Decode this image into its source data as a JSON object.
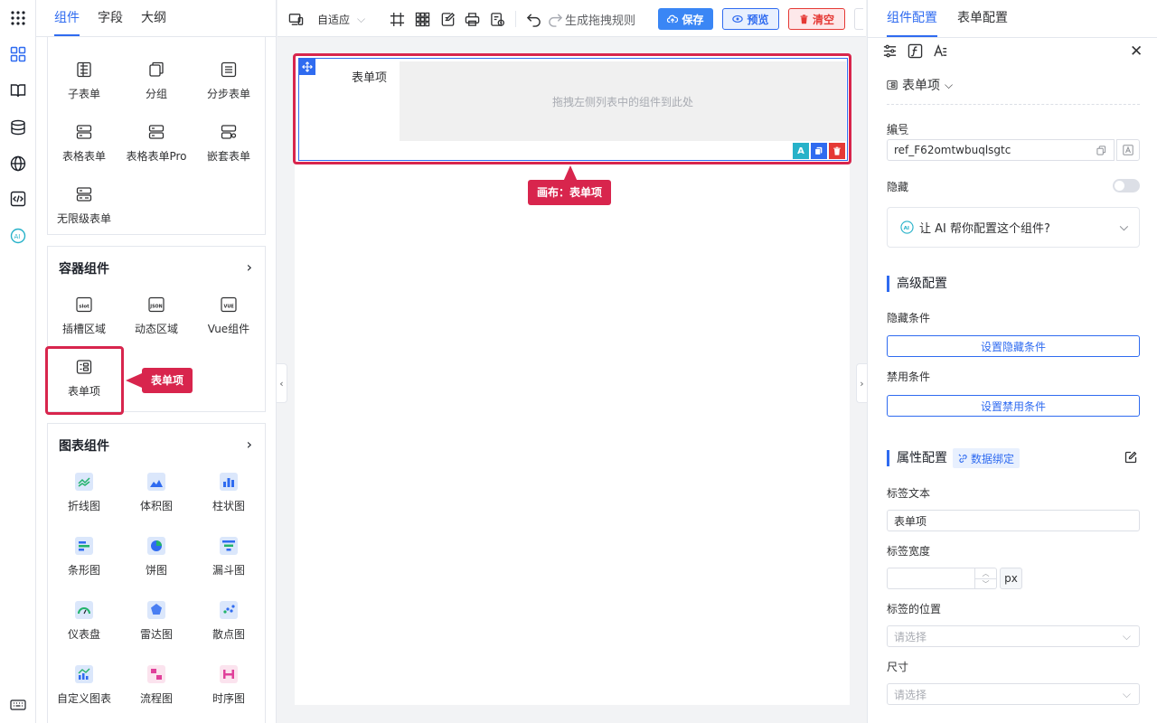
{
  "panel": {
    "tabs": [
      "组件",
      "字段",
      "大纲"
    ],
    "section1_items": [
      "子表单",
      "分组",
      "分步表单",
      "表格表单",
      "表格表单Pro",
      "嵌套表单",
      "无限级表单"
    ],
    "container_title": "容器组件",
    "container_items": [
      "插槽区域",
      "动态区域",
      "Vue组件",
      "表单项"
    ],
    "chart_title": "图表组件",
    "chart_items": [
      "折线图",
      "体积图",
      "柱状图",
      "条形图",
      "饼图",
      "漏斗图",
      "仪表盘",
      "雷达图",
      "散点图",
      "自定义图表",
      "流程图",
      "时序图"
    ],
    "icon_texts": [
      "slot",
      "JSON",
      "VUE"
    ],
    "callout": "表单项"
  },
  "toolbar": {
    "adaptive": "自适应",
    "gen_rule": "生成拖拽规则",
    "save": "保存",
    "preview": "预览",
    "clear": "清空"
  },
  "canvas": {
    "item_label": "表单项",
    "placeholder": "拖拽左侧列表中的组件到此处",
    "callout": "画布：表单项"
  },
  "right": {
    "tabs": [
      "组件配置",
      "表单配置"
    ],
    "component_name": "表单项",
    "id_label": "编号",
    "id_value": "ref_F62omtwbuqlsgtc",
    "hidden_label": "隐藏",
    "ai_prompt": "让 AI 帮你配置这个组件?",
    "advanced_title": "高级配置",
    "hide_cond_label": "隐藏条件",
    "hide_cond_btn": "设置隐藏条件",
    "disable_cond_label": "禁用条件",
    "disable_cond_btn": "设置禁用条件",
    "props_title": "属性配置",
    "data_bind": "数据绑定",
    "label_text_label": "标签文本",
    "label_text_value": "表单项",
    "label_width_label": "标签宽度",
    "px": "px",
    "label_pos_label": "标签的位置",
    "label_pos_placeholder": "请选择",
    "size_label": "尺寸",
    "size_placeholder": "请选择"
  },
  "colors": {
    "accent": "#2f6bf0",
    "highlight": "#d8254d",
    "save_bg": "#3a86f5",
    "preview_bg": "#e8f0fe",
    "clear_bg": "#fde8ea",
    "clear_text": "#e53935"
  }
}
